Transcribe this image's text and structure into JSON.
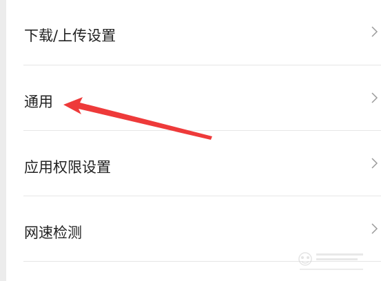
{
  "settings": {
    "items": [
      {
        "label": "下载/上传设置"
      },
      {
        "label": "通用"
      },
      {
        "label": "应用权限设置"
      },
      {
        "label": "网速检测"
      }
    ]
  },
  "colors": {
    "text": "#222222",
    "divider": "#e6e6e6",
    "chevron": "#9a9a9a",
    "arrow": "#ee3a3a",
    "strip": "#ececec"
  },
  "icons": {
    "row_indicator": "chevron-right-icon"
  }
}
